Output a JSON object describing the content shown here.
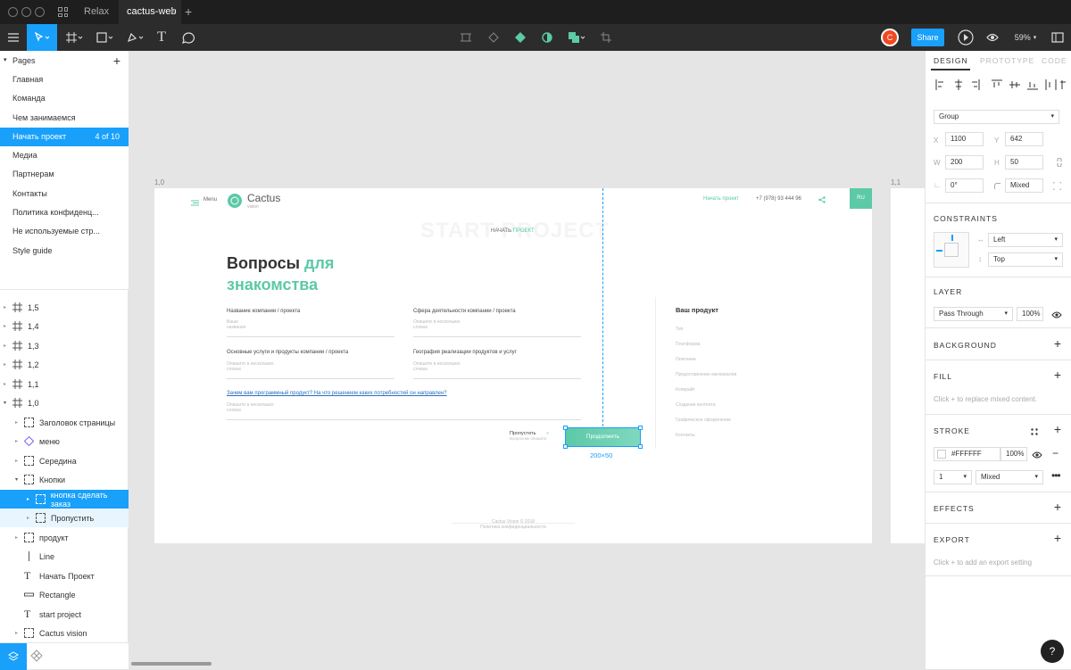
{
  "tabs": {
    "home_label": "Relax",
    "file_label": "cactus-web"
  },
  "toolbar": {
    "avatar_initial": "C",
    "share_label": "Share",
    "zoom_label": "59%"
  },
  "pages": {
    "header": "Pages",
    "items": [
      {
        "label": "Главная"
      },
      {
        "label": "Команда"
      },
      {
        "label": "Чем занимаемся"
      },
      {
        "label": "Начать проект",
        "badge": "4 of 10"
      },
      {
        "label": "Медиа"
      },
      {
        "label": "Партнерам"
      },
      {
        "label": "Контакты"
      },
      {
        "label": "Политика конфиденц..."
      },
      {
        "label": "Не используемые стр..."
      },
      {
        "label": "Style guide"
      }
    ]
  },
  "layers": [
    {
      "label": "1,5"
    },
    {
      "label": "1,4"
    },
    {
      "label": "1,3"
    },
    {
      "label": "1,2"
    },
    {
      "label": "1,1"
    },
    {
      "label": "1,0"
    },
    {
      "label": "Заголовок страницы"
    },
    {
      "label": "меню"
    },
    {
      "label": "Середина"
    },
    {
      "label": "Кнопки"
    },
    {
      "label": "кнопка сделать заказ"
    },
    {
      "label": "Пропустить"
    },
    {
      "label": "продукт"
    },
    {
      "label": "Line"
    },
    {
      "label": "Начать Проект"
    },
    {
      "label": "Rectangle"
    },
    {
      "label": "start project"
    },
    {
      "label": "Cactus vision"
    }
  ],
  "canvas": {
    "frame_label_left": "1,0",
    "frame_label_right": "1,1"
  },
  "site": {
    "menu": "Menu",
    "logo_name": "Cactus",
    "logo_sub": "vision",
    "start_project_link": "Начать проект",
    "phone": "+7 (978) 93 444 96",
    "lang": "RU",
    "bg_title": "START PROJECT",
    "crumb_a": "НАЧАТЬ",
    "crumb_b": "ПРОЕКТ",
    "heading_a": "Вопросы",
    "heading_b": "для",
    "heading_c": "знакомства",
    "q1": "Название компании / проекта",
    "p1a": "Ваше",
    "p1b": "название",
    "q2": "Сфера деятельности компании / проекта",
    "p2a": "Опишите в нескольких",
    "p2b": "словах",
    "q3": "Основные услуги и продукты компании / проекта",
    "p3a": "Опишите в нескольких",
    "p3b": "словах",
    "q4": "География реализации продуктов и услуг",
    "p4a": "Опишите в нескольких",
    "p4b": "словах",
    "q5": "Зачем вам программный продукт? На что решением каких потребностей он направлен?",
    "p5a": "Опишите в нескольких",
    "p5b": "словах",
    "skip": "Пропустить",
    "skip_sub": "Вопросник опишите",
    "continue": "Продолжить",
    "size_label": "200×50",
    "product_title": "Ваш продукт",
    "product_items": [
      "Тип",
      "Платформа",
      "Описание",
      "Предоставление материалов",
      "Копирайт",
      "Создание контента",
      "Графическое оформление",
      "Контакты"
    ],
    "footer_a": "Cactus Vision © 2018",
    "footer_b": "Политика конфиденциальности"
  },
  "design": {
    "tab_design": "DESIGN",
    "tab_prototype": "PROTOTYPE",
    "tab_code": "CODE",
    "group_label": "Group",
    "x_label": "X",
    "x": "1100",
    "y_label": "Y",
    "y": "642",
    "w_label": "W",
    "w": "200",
    "h_label": "H",
    "h": "50",
    "rotation": "0°",
    "radius": "Mixed",
    "constraints_title": "CONSTRAINTS",
    "constraint_h": "Left",
    "constraint_v": "Top",
    "layer_title": "LAYER",
    "blend": "Pass Through",
    "opacity": "100%",
    "background_title": "BACKGROUND",
    "fill_title": "FILL",
    "fill_hint": "Click + to replace mixed content.",
    "stroke_title": "STROKE",
    "stroke_color": "#FFFFFF",
    "stroke_opacity": "100%",
    "stroke_width": "1",
    "stroke_align": "Mixed",
    "effects_title": "EFFECTS",
    "export_title": "EXPORT",
    "export_hint": "Click + to add an export setting"
  },
  "help_label": "?",
  "colors": {
    "accent": "#18a0fb",
    "brand_green": "#5cc9a7",
    "avatar": "#f24822"
  }
}
